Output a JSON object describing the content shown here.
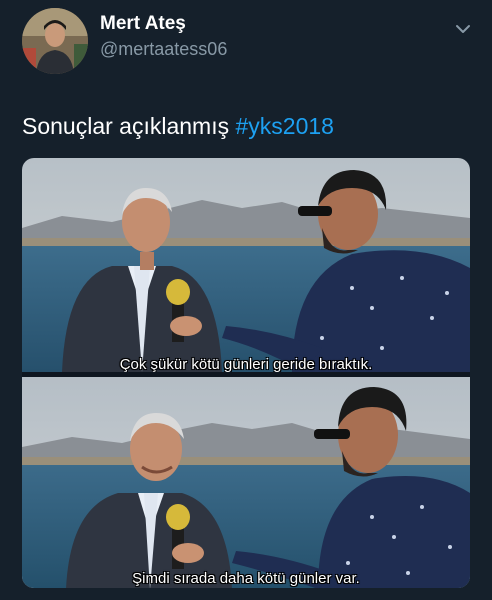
{
  "user": {
    "display_name": "Mert Ateş",
    "handle": "@mertaatess06"
  },
  "icons": {
    "menu": "chevron-down-icon",
    "avatar": "profile-photo"
  },
  "tweet": {
    "text_prefix": "Sonuçlar açıklanmış ",
    "hashtag": "#yks2018"
  },
  "media": {
    "frames": [
      {
        "subtitle": "Çok şükür kötü günleri geride bıraktık."
      },
      {
        "subtitle": "Şimdi sırada daha kötü günler var."
      }
    ]
  },
  "colors": {
    "background": "#15202b",
    "handle": "#8899a6",
    "hashtag": "#1da1f2"
  }
}
